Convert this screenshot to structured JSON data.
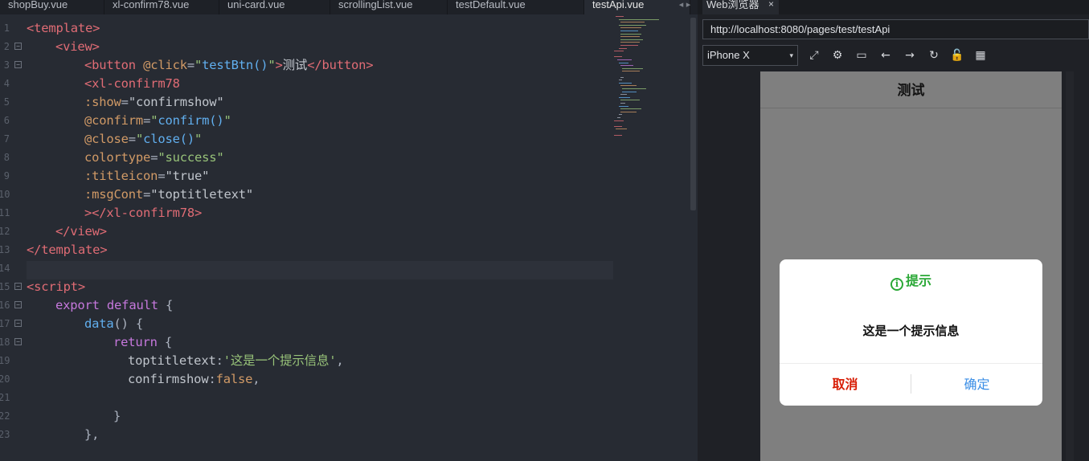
{
  "editor": {
    "tabs": [
      {
        "label": "shopBuy.vue",
        "active": false
      },
      {
        "label": "xl-confirm78.vue",
        "active": false
      },
      {
        "label": "uni-card.vue",
        "active": false
      },
      {
        "label": "scrollingList.vue",
        "active": false
      },
      {
        "label": "testDefault.vue",
        "active": false
      },
      {
        "label": "testApi.vue",
        "active": true
      }
    ],
    "tab_scroll_arrows": "◂ ▸",
    "line_numbers": [
      "1",
      "2",
      "3",
      "4",
      "5",
      "6",
      "7",
      "8",
      "9",
      "10",
      "11",
      "12",
      "13",
      "14",
      "15",
      "16",
      "17",
      "18",
      "19",
      "20",
      "21",
      "22",
      "23"
    ],
    "fold_markers": [
      "1",
      "2",
      "14",
      "15",
      "16",
      "17"
    ],
    "lines": [
      {
        "indent": 0,
        "tokens": [
          [
            "tag",
            "<template>"
          ]
        ]
      },
      {
        "indent": 1,
        "tokens": [
          [
            "tag",
            "<view>"
          ]
        ]
      },
      {
        "indent": 2,
        "tokens": [
          [
            "tag",
            "<button "
          ],
          [
            "attr",
            "@click"
          ],
          [
            "punct",
            "="
          ],
          [
            "str",
            "\""
          ],
          [
            "fn",
            "testBtn()"
          ],
          [
            "str",
            "\""
          ],
          [
            "tag",
            ">"
          ],
          [
            "plain",
            "测试"
          ],
          [
            "tag",
            "</button>"
          ]
        ]
      },
      {
        "indent": 2,
        "tokens": [
          [
            "tag",
            "<xl-confirm78"
          ]
        ]
      },
      {
        "indent": 2,
        "tokens": [
          [
            "attr",
            ":show"
          ],
          [
            "punct",
            "="
          ],
          [
            "plain",
            "\"confirmshow\""
          ]
        ]
      },
      {
        "indent": 2,
        "tokens": [
          [
            "attr",
            "@confirm"
          ],
          [
            "punct",
            "="
          ],
          [
            "str",
            "\""
          ],
          [
            "fn",
            "confirm()"
          ],
          [
            "str",
            "\""
          ]
        ]
      },
      {
        "indent": 2,
        "tokens": [
          [
            "attr",
            "@close"
          ],
          [
            "punct",
            "="
          ],
          [
            "str",
            "\""
          ],
          [
            "fn",
            "close()"
          ],
          [
            "str",
            "\""
          ]
        ]
      },
      {
        "indent": 2,
        "tokens": [
          [
            "attr",
            "colortype"
          ],
          [
            "punct",
            "="
          ],
          [
            "str",
            "\"success\""
          ]
        ]
      },
      {
        "indent": 2,
        "tokens": [
          [
            "attr",
            ":titleicon"
          ],
          [
            "punct",
            "="
          ],
          [
            "plain",
            "\"true\""
          ]
        ]
      },
      {
        "indent": 2,
        "tokens": [
          [
            "attr",
            ":msgCont"
          ],
          [
            "punct",
            "="
          ],
          [
            "plain",
            "\"toptitletext\""
          ]
        ]
      },
      {
        "indent": 2,
        "tokens": [
          [
            "tag",
            "></xl-confirm78>"
          ]
        ]
      },
      {
        "indent": 1,
        "tokens": [
          [
            "tag",
            "</view>"
          ]
        ]
      },
      {
        "indent": 0,
        "tokens": [
          [
            "tag",
            "</template>"
          ]
        ]
      },
      {
        "indent": 0,
        "tokens": [],
        "highlight": true
      },
      {
        "indent": 0,
        "tokens": [
          [
            "tag",
            "<script>"
          ]
        ]
      },
      {
        "indent": 1,
        "tokens": [
          [
            "kw",
            "export default"
          ],
          [
            "punct",
            " {"
          ]
        ]
      },
      {
        "indent": 2,
        "tokens": [
          [
            "fn",
            "data"
          ],
          [
            "punct",
            "() {"
          ]
        ]
      },
      {
        "indent": 3,
        "tokens": [
          [
            "kw",
            "return"
          ],
          [
            "punct",
            " {"
          ]
        ]
      },
      {
        "indent": 3.5,
        "tokens": [
          [
            "plain",
            "toptitletext"
          ],
          [
            "punct",
            ":"
          ],
          [
            "str",
            "'这是一个提示信息'"
          ],
          [
            "punct",
            ","
          ]
        ]
      },
      {
        "indent": 3.5,
        "tokens": [
          [
            "plain",
            "confirmshow"
          ],
          [
            "punct",
            ":"
          ],
          [
            "attr",
            "false"
          ],
          [
            "punct",
            ","
          ]
        ]
      },
      {
        "indent": 0,
        "tokens": []
      },
      {
        "indent": 3,
        "tokens": [
          [
            "punct",
            "}"
          ]
        ]
      },
      {
        "indent": 2,
        "tokens": [
          [
            "punct",
            "},"
          ]
        ]
      }
    ]
  },
  "browser": {
    "tab_label": "Web浏览器",
    "tab_close": "×",
    "url": "http://localhost:8080/pages/test/testApi",
    "device": "iPhone X",
    "device_caret": "▾",
    "toolbar_icons": [
      {
        "name": "rotate-icon",
        "glyph": "⤢"
      },
      {
        "name": "settings-icon",
        "glyph": "⚙"
      },
      {
        "name": "console-icon",
        "glyph": "▭"
      },
      {
        "name": "back-icon",
        "glyph": "←"
      },
      {
        "name": "forward-icon",
        "glyph": "→"
      },
      {
        "name": "reload-icon",
        "glyph": "↻"
      },
      {
        "name": "lock-icon",
        "glyph": "🔓"
      },
      {
        "name": "qrcode-icon",
        "glyph": "▦"
      }
    ]
  },
  "phone": {
    "nav_title": "测试",
    "dialog": {
      "icon": "i",
      "title": "提示",
      "message": "这是一个提示信息",
      "cancel_label": "取消",
      "confirm_label": "确定"
    }
  },
  "colors": {
    "success_green": "#2aa836",
    "cancel_red": "#d81e06",
    "confirm_blue": "#3a8ee6"
  }
}
